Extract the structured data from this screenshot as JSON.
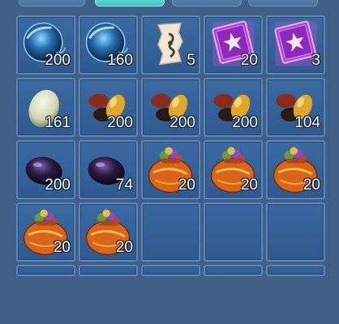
{
  "inventory": {
    "tabs_visible": 4,
    "active_tab": 1,
    "rows": [
      [
        {
          "icon": "blue-orb-icon",
          "count": "200"
        },
        {
          "icon": "blue-orb-icon",
          "count": "160"
        },
        {
          "icon": "scroll-rune-icon",
          "count": "5"
        },
        {
          "icon": "purple-ticket-icon",
          "count": "20"
        },
        {
          "icon": "purple-ticket-icon",
          "count": "3"
        }
      ],
      [
        {
          "icon": "pale-egg-icon",
          "count": "161"
        },
        {
          "icon": "beans-pile-icon",
          "count": "200"
        },
        {
          "icon": "beans-pile-icon",
          "count": "200"
        },
        {
          "icon": "beans-pile-icon",
          "count": "200"
        },
        {
          "icon": "beans-pile-icon",
          "count": "104"
        }
      ],
      [
        {
          "icon": "dark-egg-icon",
          "count": "200"
        },
        {
          "icon": "dark-egg-icon",
          "count": "74"
        },
        {
          "icon": "orange-sack-icon",
          "count": "20"
        },
        {
          "icon": "orange-sack-icon",
          "count": "20"
        },
        {
          "icon": "orange-sack-icon",
          "count": "20"
        }
      ],
      [
        {
          "icon": "orange-sack-icon",
          "count": "20"
        },
        {
          "icon": "orange-sack-icon",
          "count": "20"
        },
        {
          "icon": "",
          "count": ""
        },
        {
          "icon": "",
          "count": ""
        },
        {
          "icon": "",
          "count": ""
        }
      ]
    ]
  }
}
